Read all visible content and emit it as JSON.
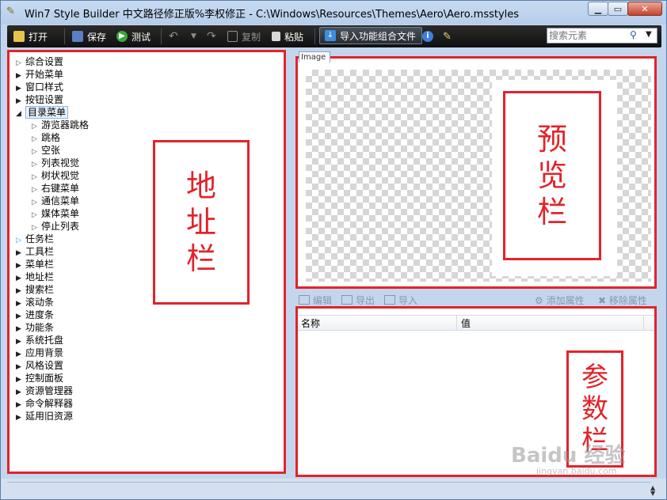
{
  "window": {
    "title": "Win7 Style Builder 中文路径修正版%李权修正 - C:\\Windows\\Resources\\Themes\\Aero\\Aero.msstyles",
    "minimize": "▁",
    "maximize": "▭",
    "close": "✕"
  },
  "toolbar": {
    "open": "打开",
    "save": "保存",
    "test": "测试",
    "copy": "复制",
    "paste": "粘贴",
    "import_combo": "导入功能组合文件",
    "search_placeholder": "搜索元素"
  },
  "tree": {
    "items": [
      {
        "label": "综合设置"
      },
      {
        "label": "开始菜单"
      },
      {
        "label": "窗口样式"
      },
      {
        "label": "按钮设置"
      },
      {
        "label": "目录菜单"
      },
      {
        "label": "游览器跳格"
      },
      {
        "label": "跳格"
      },
      {
        "label": "空张"
      },
      {
        "label": "列表视觉"
      },
      {
        "label": "树状视觉"
      },
      {
        "label": "右键菜单"
      },
      {
        "label": "通信菜单"
      },
      {
        "label": "媒体菜单"
      },
      {
        "label": "停止列表"
      },
      {
        "label": "任务栏"
      },
      {
        "label": "工具栏"
      },
      {
        "label": "菜单栏"
      },
      {
        "label": "地址栏"
      },
      {
        "label": "搜索栏"
      },
      {
        "label": "滚动条"
      },
      {
        "label": "进度条"
      },
      {
        "label": "功能条"
      },
      {
        "label": "系统托盘"
      },
      {
        "label": "应用背景"
      },
      {
        "label": "风格设置"
      },
      {
        "label": "控制面板"
      },
      {
        "label": "资源管理器"
      },
      {
        "label": "命令解释器"
      },
      {
        "label": "延用旧资源"
      }
    ]
  },
  "annotations": {
    "address": [
      "地",
      "址",
      "栏"
    ],
    "preview": [
      "预",
      "览",
      "栏"
    ],
    "params": [
      "参",
      "数",
      "栏"
    ]
  },
  "preview": {
    "tab_label": "Image"
  },
  "prop_toolbar": {
    "edit": "编辑",
    "export": "导出",
    "import": "导入",
    "add_attr": "添加属性",
    "remove_attr": "移除属性"
  },
  "params": {
    "col_name": "名称",
    "col_value": "值"
  },
  "watermark": {
    "logo": "Baidu 经验",
    "url": "jingyan.baidu.com"
  },
  "colors": {
    "annotation_red": "#e2232a",
    "toolbar_bg": "#1a1a1a"
  }
}
